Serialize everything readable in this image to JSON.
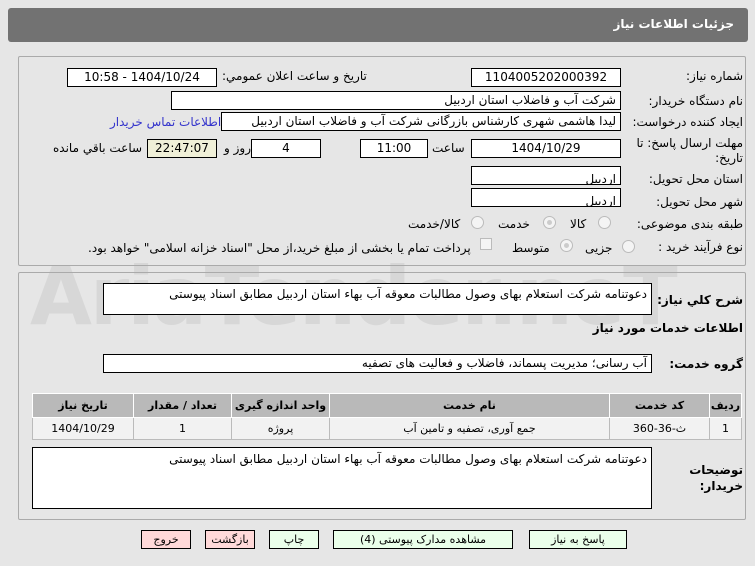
{
  "header": {
    "title": "جزئیات اطلاعات نیاز"
  },
  "form": {
    "need_number_label": "شماره نیاز:",
    "need_number": "1104005202000392",
    "announce_label": "تاریخ و ساعت اعلان عمومي:",
    "announce_value": "1404/10/24 - 10:58",
    "buyer_label": "نام دستگاه خریدار:",
    "buyer_value": "شرکت آب و فاضلاب استان اردبیل",
    "creator_label": "ایجاد کننده درخواست:",
    "creator_value": "لیدا  هاشمی شهری کارشناس بازرگانی شرکت آب و فاضلاب استان اردبیل",
    "contact_link": "اطلاعات تماس خریدار",
    "deadline_label": "مهلت ارسال پاسخ: تا تاریخ:",
    "deadline_date": "1404/10/29",
    "time_label": "ساعت",
    "deadline_time": "11:00",
    "days_value": "4",
    "days_label": "روز و",
    "remaining_time": "22:47:07",
    "remaining_label": "ساعت باقي مانده",
    "province_label": "استان محل تحویل:",
    "province_value": "اردبیل",
    "city_label": "شهر محل تحویل:",
    "city_value": "اردبیل",
    "category_label": "طبقه بندی موضوعی:",
    "category_options": [
      "کالا",
      "خدمت",
      "کالا/خدمت"
    ],
    "category_selected": "خدمت",
    "process_label": "نوع فرآیند خرید :",
    "process_options": [
      "جزیی",
      "متوسط"
    ],
    "process_selected": "متوسط",
    "payment_note": "پرداخت تمام یا بخشی از مبلغ خرید،از محل \"اسناد خزانه اسلامی\" خواهد بود."
  },
  "details": {
    "description_label": "شرح کلي نیاز:",
    "description_value": "دعوتنامه شرکت استعلام بهای وصول مطالبات معوقه آب بهاء استان اردبیل مطابق اسناد پیوستی",
    "services_title": "اطلاعات خدمات مورد نیاز",
    "group_label": "گروه خدمت:",
    "group_value": "آب رسانی؛ مدیریت پسماند، فاضلاب و فعالیت های تصفیه",
    "table": {
      "headers": [
        "ردیف",
        "کد خدمت",
        "نام خدمت",
        "واحد اندازه گیری",
        "تعداد / مقدار",
        "تاریخ نیاز"
      ],
      "rows": [
        [
          "1",
          "ث-36-360",
          "جمع آوری، تصفیه و تامین آب",
          "پروژه",
          "1",
          "1404/10/29"
        ]
      ]
    },
    "buyer_notes_label": "توضیحات خریدار:",
    "buyer_notes_value": "دعوتنامه شرکت استعلام بهای وصول مطالبات معوقه آب بهاء استان اردبیل مطابق اسناد پیوستی"
  },
  "buttons": {
    "reply": "پاسخ به نیاز",
    "attachments": "مشاهده مدارک پیوستی (4)",
    "print": "چاپ",
    "back": "بازگشت",
    "exit": "خروج"
  },
  "watermark": "AriaTender.net"
}
